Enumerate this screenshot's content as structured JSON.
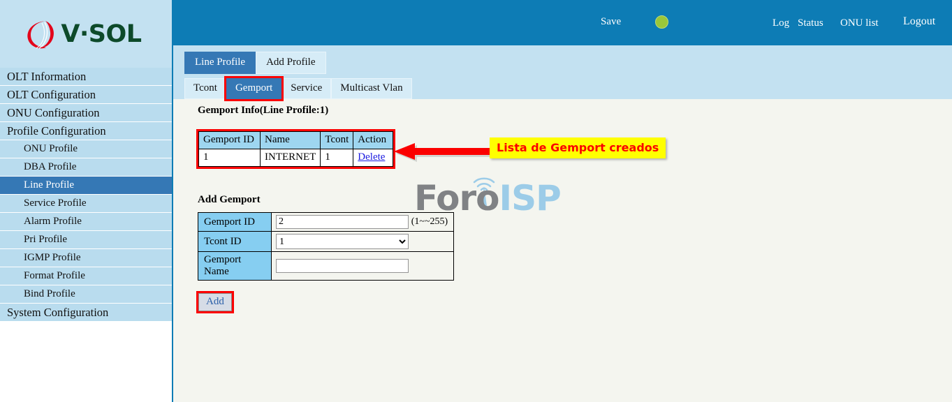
{
  "brand": {
    "name": "V·SOL",
    "logo_icon": "vsol-swirl-logo"
  },
  "header": {
    "save_label": "Save",
    "status_indicator": "green-status-dot",
    "status_color": "#9ac73a",
    "links": {
      "log": "Log",
      "status": "Status",
      "onu_list": "ONU list",
      "logout": "Logout"
    },
    "background_color": "#0d7cb5"
  },
  "sidebar": {
    "items": [
      {
        "label": "OLT Information",
        "sub": false,
        "active": false
      },
      {
        "label": "OLT Configuration",
        "sub": false,
        "active": false
      },
      {
        "label": "ONU Configuration",
        "sub": false,
        "active": false
      },
      {
        "label": "Profile Configuration",
        "sub": false,
        "active": false
      },
      {
        "label": "ONU Profile",
        "sub": true,
        "active": false
      },
      {
        "label": "DBA Profile",
        "sub": true,
        "active": false
      },
      {
        "label": "Line Profile",
        "sub": true,
        "active": true
      },
      {
        "label": "Service Profile",
        "sub": true,
        "active": false
      },
      {
        "label": "Alarm Profile",
        "sub": true,
        "active": false
      },
      {
        "label": "Pri Profile",
        "sub": true,
        "active": false
      },
      {
        "label": "IGMP Profile",
        "sub": true,
        "active": false
      },
      {
        "label": "Format Profile",
        "sub": true,
        "active": false
      },
      {
        "label": "Bind Profile",
        "sub": true,
        "active": false
      },
      {
        "label": "System Configuration",
        "sub": false,
        "active": false
      }
    ],
    "active_color": "#3578b5",
    "item_color": "#b9dcee"
  },
  "tabs": {
    "primary": [
      {
        "label": "Line Profile",
        "active": true,
        "highlight": false
      },
      {
        "label": "Add Profile",
        "active": false,
        "highlight": false
      }
    ],
    "secondary": [
      {
        "label": "Tcont",
        "active": false,
        "highlight": false
      },
      {
        "label": "Gemport",
        "active": true,
        "highlight": true
      },
      {
        "label": "Service",
        "active": false,
        "highlight": false
      },
      {
        "label": "Multicast Vlan",
        "active": false,
        "highlight": false
      }
    ]
  },
  "main": {
    "info_title": "Gemport Info(Line Profile:1)",
    "info_table": {
      "headers": [
        "Gemport ID",
        "Name",
        "Tcont",
        "Action"
      ],
      "rows": [
        {
          "gemport_id": "1",
          "name": "INTERNET",
          "tcont": "1",
          "action": "Delete"
        }
      ]
    },
    "annotation": {
      "text": "Lista de Gemport creados",
      "text_color": "#fb0000",
      "background_color": "#ffff00",
      "arrow": "left-arrow-annotation",
      "arrow_color": "#fb0000"
    },
    "add_title": "Add Gemport",
    "form": {
      "gemport_id_label": "Gemport ID",
      "gemport_id_value": "2",
      "gemport_id_hint": "(1~~255)",
      "tcont_id_label": "Tcont ID",
      "tcont_id_value": "1",
      "tcont_id_options": [
        "1"
      ],
      "gemport_name_label": "Gemport Name",
      "gemport_name_value": "",
      "gemport_name_placeholder": ""
    },
    "add_button_label": "Add",
    "add_button_highlight_color": "#fb0000"
  },
  "watermark": {
    "part1": "Foro",
    "part2": "ISP",
    "icon": "wifi-tower-icon",
    "part1_color": "#808285",
    "part2_color": "#9ccce8"
  }
}
